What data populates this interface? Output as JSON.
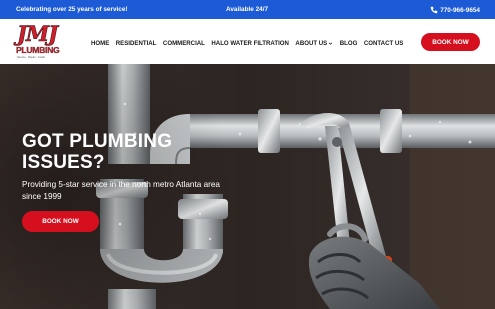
{
  "topbar": {
    "left_text": "Celebrating over 25 years of service!",
    "center_text": "Available 24/7",
    "phone": "770-966-9654",
    "phone_icon": "phone-icon",
    "background": "#1d5bd6"
  },
  "logo": {
    "main": "JMJ",
    "word": "PLUMBING",
    "tagline": "Service · Repair · Install"
  },
  "nav": {
    "items": [
      {
        "label": "HOME"
      },
      {
        "label": "RESIDENTIAL"
      },
      {
        "label": "COMMERCIAL"
      },
      {
        "label": "HALO WATER FILTRATION"
      },
      {
        "label": "ABOUT US",
        "has_dropdown": true
      },
      {
        "label": "BLOG"
      },
      {
        "label": "CONTACT US"
      }
    ],
    "book_label": "BOOK NOW"
  },
  "hero": {
    "title_line1": "GOT PLUMBING",
    "title_line2": "ISSUES?",
    "subtitle": "Providing 5-star service in the north metro Atlanta area since 1999",
    "button_label": "BOOK NOW",
    "accent": "#d60f1f"
  }
}
